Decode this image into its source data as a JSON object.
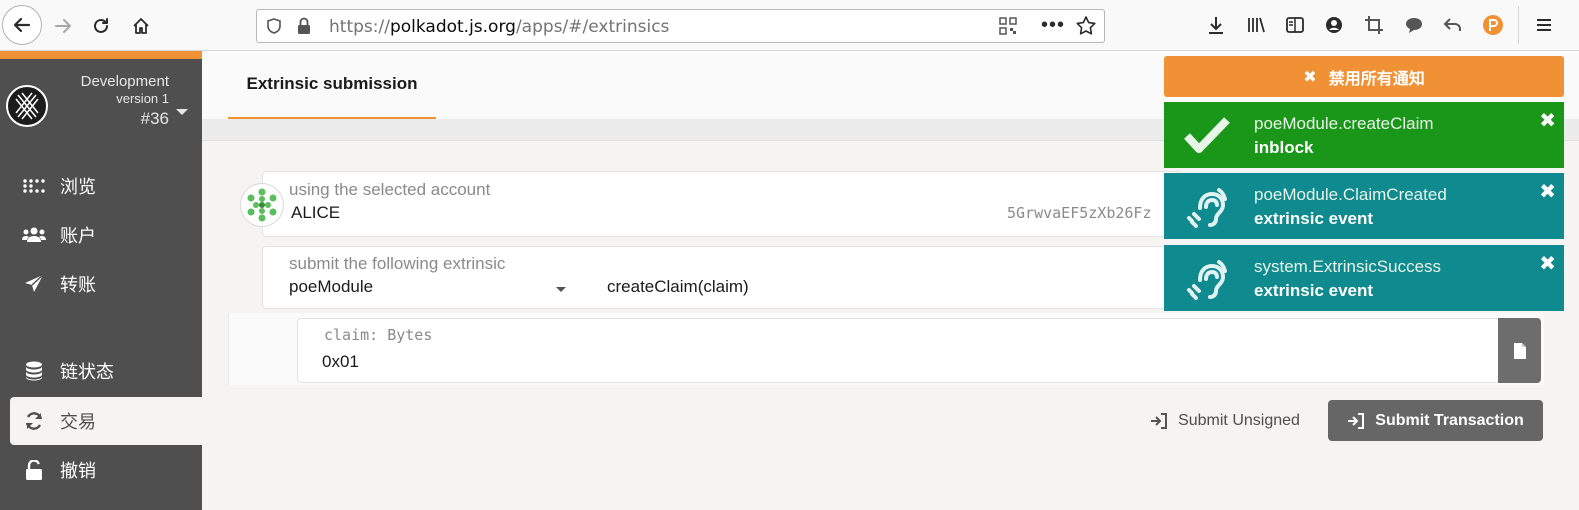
{
  "browser": {
    "url_prefix": "https://",
    "url_domain": "polkadot.js.org",
    "url_path": "/apps/#/extrinsics"
  },
  "chain": {
    "name": "Development",
    "version": "version 1",
    "block": "#36"
  },
  "sidebar": {
    "items": [
      {
        "label": "浏览",
        "icon": "explorer-icon"
      },
      {
        "label": "账户",
        "icon": "users-icon"
      },
      {
        "label": "转账",
        "icon": "send-icon"
      },
      {
        "label": "链状态",
        "icon": "database-icon"
      },
      {
        "label": "交易",
        "icon": "sync-icon"
      },
      {
        "label": "撤销",
        "icon": "unlock-icon"
      }
    ]
  },
  "main": {
    "tab_label": "Extrinsic submission",
    "account": {
      "label": "using the selected account",
      "name": "ALICE",
      "address": "5GrwvaEF5zXb26Fz"
    },
    "extrinsic": {
      "label": "submit the following extrinsic",
      "module": "poeModule",
      "method": "createClaim(claim)"
    },
    "param": {
      "label": "claim: Bytes",
      "value": "0x01"
    },
    "submit_unsigned": "Submit Unsigned",
    "submit_transaction": "Submit Transaction"
  },
  "notifications": {
    "dismiss_all": "禁用所有通知",
    "items": [
      {
        "title": "poeModule.createClaim",
        "status": "inblock",
        "color": "#1a9618",
        "icon": "check-icon"
      },
      {
        "title": "poeModule.ClaimCreated",
        "status": "extrinsic event",
        "color": "#0f8a8e",
        "icon": "ear-listen-icon"
      },
      {
        "title": "system.ExtrinsicSuccess",
        "status": "extrinsic event",
        "color": "#0f8a8e",
        "icon": "ear-listen-icon"
      }
    ]
  },
  "colors": {
    "accent": "#f19135",
    "sidebar_bg": "#4f4f4f",
    "success": "#1a9618",
    "event": "#0f8a8e"
  }
}
